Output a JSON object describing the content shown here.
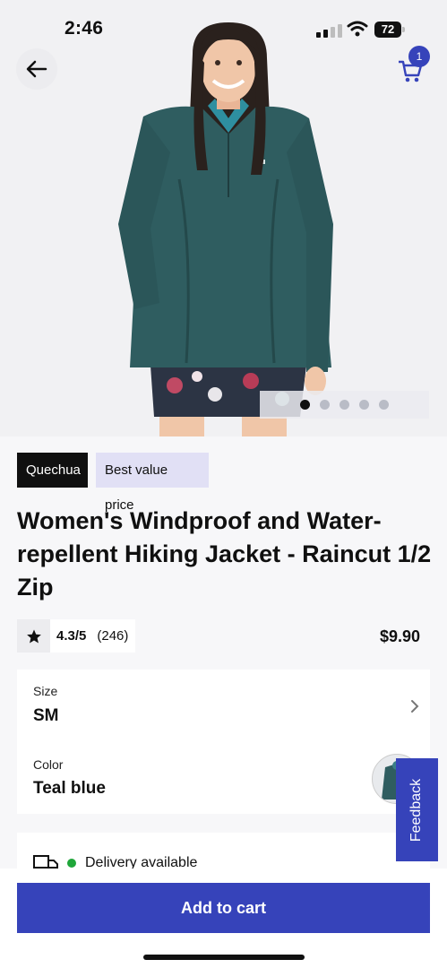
{
  "status_bar": {
    "time": "2:46",
    "battery": "72"
  },
  "header": {
    "cart_count": "1",
    "icons": [
      "arrow-left-icon",
      "cart-icon"
    ]
  },
  "gallery": {
    "image_count": 5,
    "active_index": 0
  },
  "tags": {
    "brand": "Quechua",
    "badge": "Best value price"
  },
  "product": {
    "title": "Women's Windproof and Water-repellent Hiking Jacket - Raincut 1/2 Zip",
    "rating_score": "4.3/5",
    "rating_count": "(246)",
    "price": "$9.90"
  },
  "options": {
    "size_label": "Size",
    "size_value": "SM",
    "color_label": "Color",
    "color_value": "Teal blue"
  },
  "delivery": {
    "text": "Delivery available"
  },
  "feedback": {
    "label": "Feedback"
  },
  "cta": {
    "add_to_cart": "Add to cart"
  },
  "colors": {
    "accent": "#3643ba",
    "jacket": "#2f5d60",
    "available": "#1fa63a",
    "brand_tag": "#101010",
    "badge_tag": "#e1e0f5"
  }
}
